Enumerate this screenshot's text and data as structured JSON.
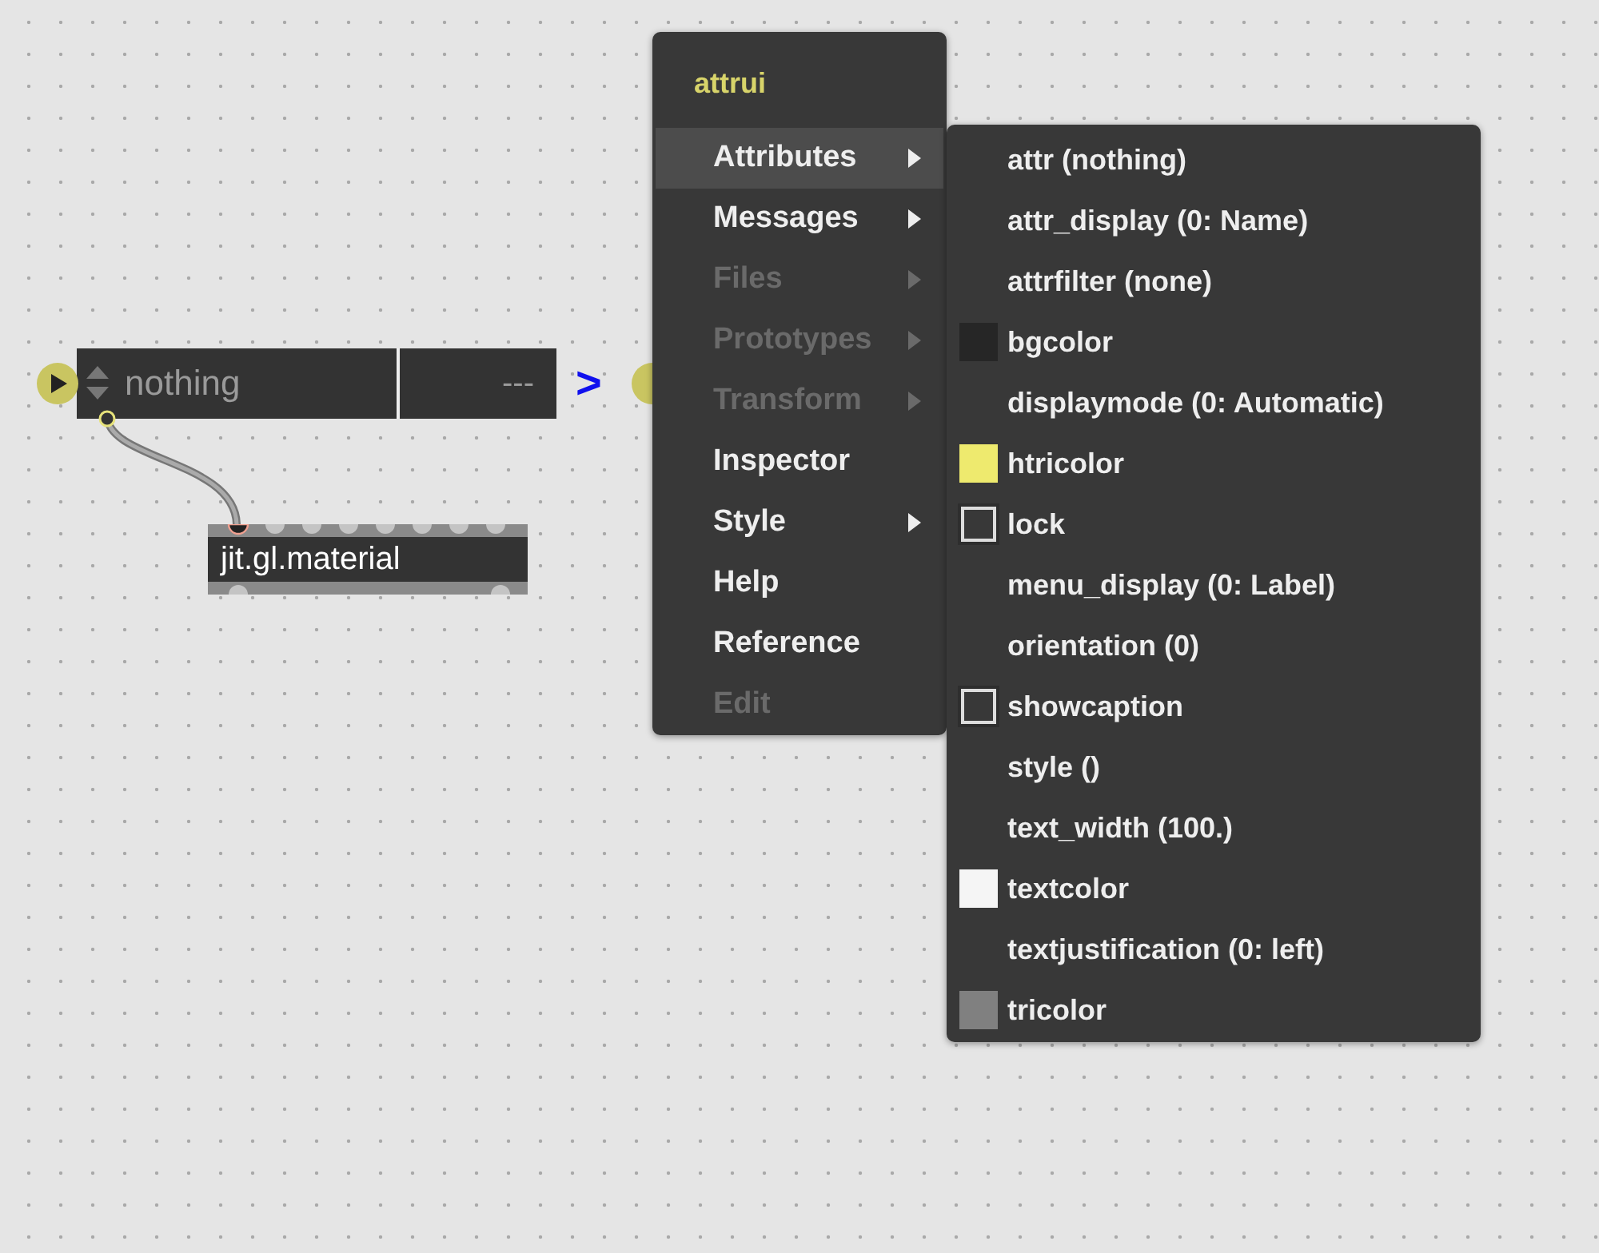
{
  "attrui": {
    "value": "nothing",
    "readout": "---"
  },
  "arrow_label": ">",
  "material_object": {
    "text": "jit.gl.material"
  },
  "context_menu": {
    "title": "attrui",
    "items": [
      {
        "label": "Attributes",
        "submenu": true,
        "disabled": false,
        "selected": true
      },
      {
        "label": "Messages",
        "submenu": true,
        "disabled": false,
        "selected": false
      },
      {
        "label": "Files",
        "submenu": true,
        "disabled": true,
        "selected": false
      },
      {
        "label": "Prototypes",
        "submenu": true,
        "disabled": true,
        "selected": false
      },
      {
        "label": "Transform",
        "submenu": true,
        "disabled": true,
        "selected": false
      },
      {
        "label": "Inspector",
        "submenu": false,
        "disabled": false,
        "selected": false
      },
      {
        "label": "Style",
        "submenu": true,
        "disabled": false,
        "selected": false
      },
      {
        "label": "Help",
        "submenu": false,
        "disabled": false,
        "selected": false
      },
      {
        "label": "Reference",
        "submenu": false,
        "disabled": false,
        "selected": false
      },
      {
        "label": "Edit",
        "submenu": false,
        "disabled": true,
        "selected": false
      }
    ]
  },
  "attributes_submenu": {
    "items": [
      {
        "kind": "plain",
        "label": "attr (nothing)"
      },
      {
        "kind": "plain",
        "label": "attr_display (0: Name)"
      },
      {
        "kind": "plain",
        "label": "attrfilter (none)"
      },
      {
        "kind": "swatch",
        "label": "bgcolor",
        "color": "#262626"
      },
      {
        "kind": "plain",
        "label": "displaymode (0: Automatic)"
      },
      {
        "kind": "swatch",
        "label": "htricolor",
        "color": "#eeea6e"
      },
      {
        "kind": "checkbox",
        "label": "lock",
        "checked": false
      },
      {
        "kind": "plain",
        "label": "menu_display (0: Label)"
      },
      {
        "kind": "plain",
        "label": "orientation (0)"
      },
      {
        "kind": "checkbox",
        "label": "showcaption",
        "checked": false
      },
      {
        "kind": "plain",
        "label": "style ()"
      },
      {
        "kind": "plain",
        "label": "text_width (100.)"
      },
      {
        "kind": "swatch",
        "label": "textcolor",
        "color": "#f5f5f5"
      },
      {
        "kind": "plain",
        "label": "textjustification (0: left)"
      },
      {
        "kind": "swatch",
        "label": "tricolor",
        "color": "#808080"
      }
    ]
  }
}
